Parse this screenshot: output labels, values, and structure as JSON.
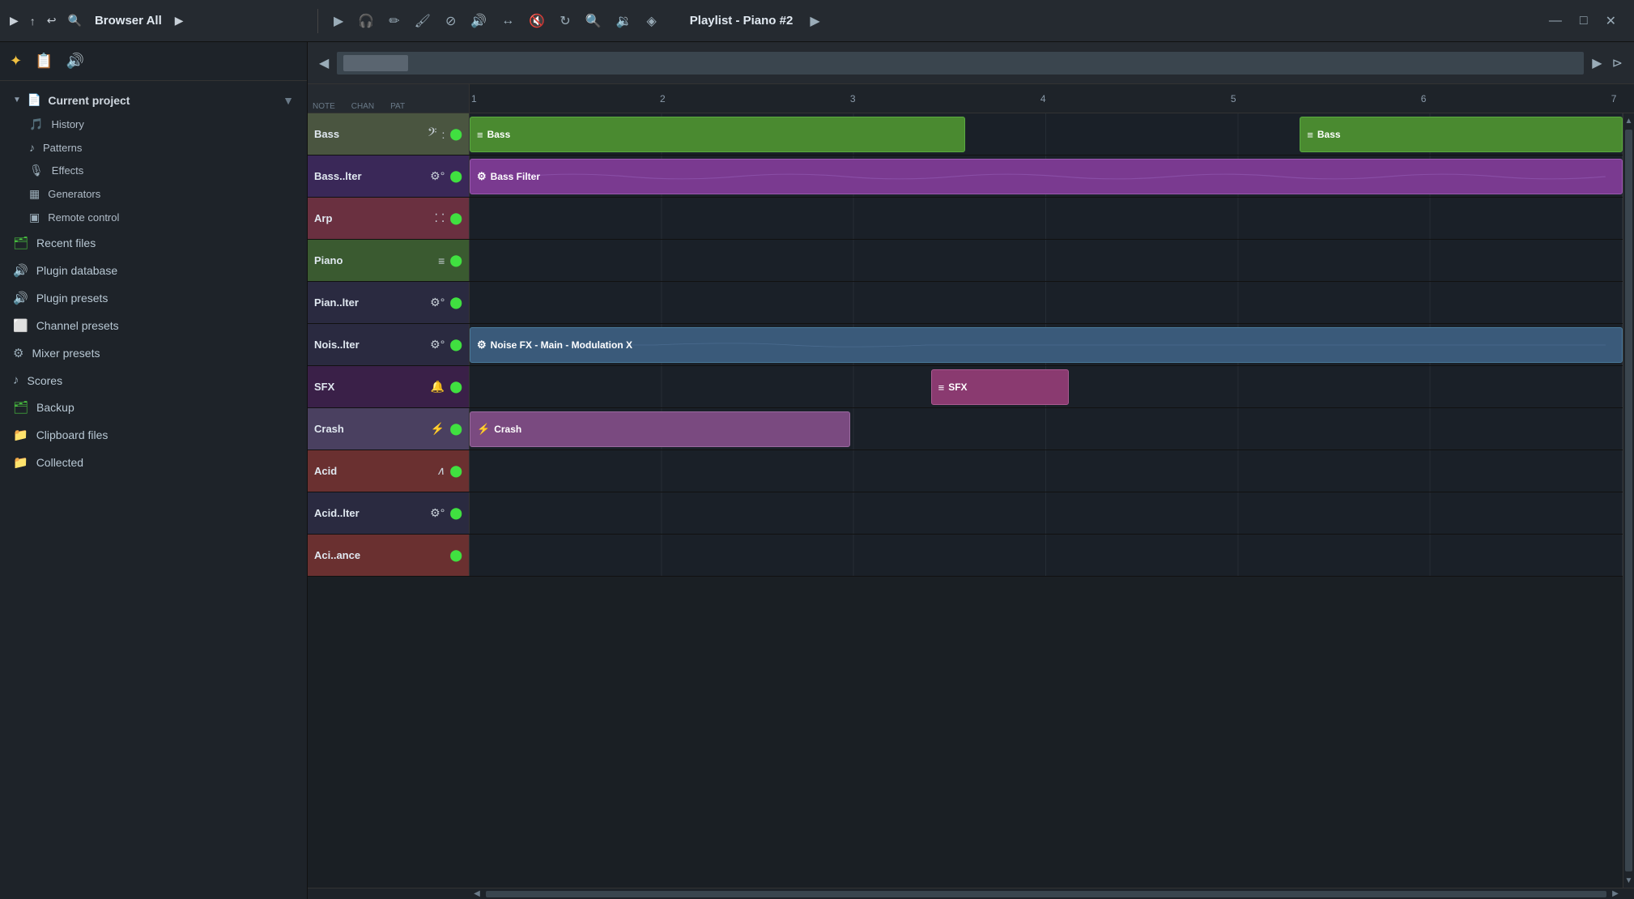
{
  "app": {
    "title": "Browser All",
    "playlist_title": "Playlist - Piano #2"
  },
  "toolbar": {
    "play_icon": "▶",
    "browser_label": "Browser - All",
    "arrow_right": "▶",
    "arrow_left": "◀",
    "arrow_up": "↑",
    "undo_icon": "↩",
    "search_icon": "🔍",
    "minimize": "—",
    "maximize": "□",
    "close": "✕"
  },
  "sidebar": {
    "tools": [
      "✦",
      "📋",
      "🔊"
    ],
    "current_project": "Current project",
    "items": [
      {
        "id": "history",
        "label": "History",
        "icon": "🎵",
        "color": "purple"
      },
      {
        "id": "patterns",
        "label": "Patterns",
        "icon": "♪",
        "color": "default"
      },
      {
        "id": "effects",
        "label": "Effects",
        "icon": "🎙",
        "color": "default"
      },
      {
        "id": "generators",
        "label": "Generators",
        "icon": "▦",
        "color": "default"
      },
      {
        "id": "remote-control",
        "label": "Remote control",
        "icon": "▣",
        "color": "default"
      }
    ],
    "root_items": [
      {
        "id": "recent-files",
        "label": "Recent files",
        "icon": "🗂",
        "color": "green"
      },
      {
        "id": "plugin-database",
        "label": "Plugin database",
        "icon": "🔊",
        "color": "purple"
      },
      {
        "id": "plugin-presets",
        "label": "Plugin presets",
        "icon": "🔊",
        "color": "purple"
      },
      {
        "id": "channel-presets",
        "label": "Channel presets",
        "icon": "⬜",
        "color": "pink"
      },
      {
        "id": "mixer-presets",
        "label": "Mixer presets",
        "icon": "⚙",
        "color": "default"
      },
      {
        "id": "scores",
        "label": "Scores",
        "icon": "♪",
        "color": "default"
      },
      {
        "id": "backup",
        "label": "Backup",
        "icon": "🗂",
        "color": "green"
      },
      {
        "id": "clipboard-files",
        "label": "Clipboard files",
        "icon": "📁",
        "color": "default"
      },
      {
        "id": "collected",
        "label": "Collected",
        "icon": "📁",
        "color": "default"
      }
    ]
  },
  "timeline": {
    "markers": [
      "1",
      "2",
      "3",
      "4",
      "5",
      "6",
      "7"
    ],
    "col_labels": [
      "NOTE",
      "CHAN",
      "PAT"
    ]
  },
  "tracks": [
    {
      "id": "bass",
      "label": "Bass",
      "icon": "𝄢",
      "icon_type": "bass-clef",
      "bg_color": "#5a6040",
      "clips": [
        {
          "id": "bass-clip-1",
          "label": "Bass",
          "start_pct": 0,
          "width_pct": 44,
          "color": "clip-green",
          "icon": "≡"
        },
        {
          "id": "bass-clip-2",
          "label": "Bass",
          "start_pct": 73,
          "width_pct": 27,
          "color": "clip-green",
          "icon": "≡"
        }
      ]
    },
    {
      "id": "bass-filter",
      "label": "Bass..lter",
      "icon": "⚙",
      "icon_type": "automation",
      "bg_color": "#3a2858",
      "clips": [
        {
          "id": "bassfilter-clip-1",
          "label": "Bass Filter",
          "start_pct": 0,
          "width_pct": 100,
          "color": "clip-purple",
          "icon": "⚙"
        }
      ]
    },
    {
      "id": "arp",
      "label": "Arp",
      "icon": "⁚",
      "icon_type": "arp",
      "bg_color": "#6a3040",
      "clips": []
    },
    {
      "id": "piano",
      "label": "Piano",
      "icon": "≡",
      "icon_type": "piano-roll",
      "bg_color": "#3a5a30",
      "clips": []
    },
    {
      "id": "piano-filter",
      "label": "Pian..lter",
      "icon": "⚙",
      "icon_type": "automation",
      "bg_color": "#2a2a40",
      "clips": []
    },
    {
      "id": "noise-filter",
      "label": "Nois..lter",
      "icon": "⚙",
      "icon_type": "automation",
      "bg_color": "#2a2a40",
      "clips": [
        {
          "id": "noisefilter-clip-1",
          "label": "Noise FX - Main - Modulation X",
          "start_pct": 0,
          "width_pct": 100,
          "color": "clip-blue",
          "icon": "⚙"
        }
      ]
    },
    {
      "id": "sfx",
      "label": "SFX",
      "icon": "🔔",
      "icon_type": "sfx",
      "bg_color": "#3a2048",
      "clips": [
        {
          "id": "sfx-clip-1",
          "label": "SFX",
          "start_pct": 40,
          "width_pct": 12,
          "color": "clip-sfx-pink",
          "icon": "≡"
        }
      ]
    },
    {
      "id": "crash",
      "label": "Crash",
      "icon": "⚡",
      "icon_type": "crash",
      "bg_color": "#4a4060",
      "clips": [
        {
          "id": "crash-clip-1",
          "label": "Crash",
          "start_pct": 0,
          "width_pct": 35,
          "color": "clip-crash-purple",
          "icon": "⚡"
        }
      ]
    },
    {
      "id": "acid",
      "label": "Acid",
      "icon": "∧",
      "icon_type": "acid",
      "bg_color": "#6a3030",
      "clips": []
    },
    {
      "id": "acid-filter",
      "label": "Acid..lter",
      "icon": "⚙",
      "icon_type": "automation",
      "bg_color": "#2a2a40",
      "clips": []
    },
    {
      "id": "aciance",
      "label": "Aci..ance",
      "icon": "",
      "icon_type": "aciance",
      "bg_color": "#6a3030",
      "clips": []
    }
  ]
}
